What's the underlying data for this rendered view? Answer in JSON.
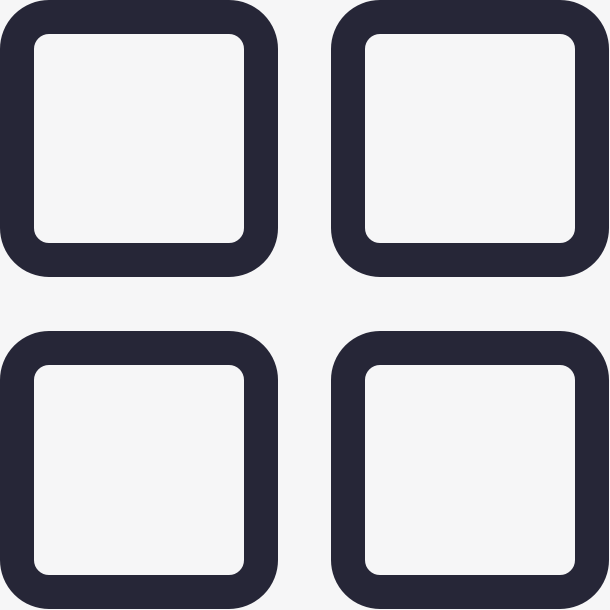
{
  "icon": {
    "name": "grid-view-icon",
    "cells": 4,
    "stroke_color": "#262637",
    "background_color": "#f6f6f7"
  }
}
